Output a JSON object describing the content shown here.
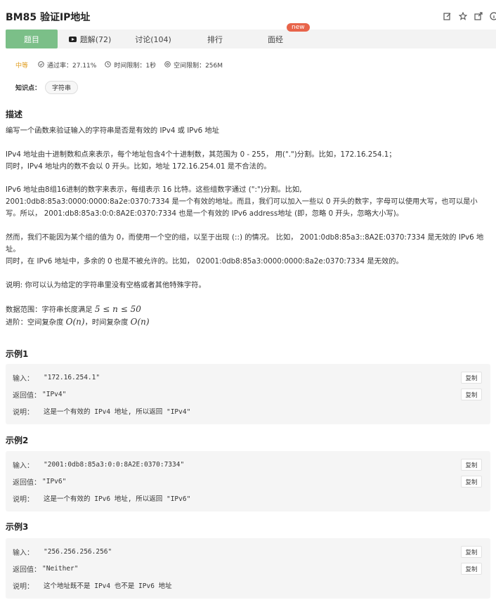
{
  "header": {
    "title": "BM85  验证IP地址",
    "icons": [
      "edit-icon",
      "star-icon",
      "share-icon",
      "info-icon"
    ]
  },
  "tabs": [
    {
      "label": "题目",
      "active": true
    },
    {
      "label": "题解(72)",
      "icon": "video-icon"
    },
    {
      "label": "讨论(104)"
    },
    {
      "label": "排行"
    },
    {
      "label": "面经",
      "badge": "new"
    }
  ],
  "meta": {
    "difficulty": "中等",
    "pass_rate": "通过率：27.11%",
    "time_limit": "时间限制：1秒",
    "space_limit": "空间限制：256M"
  },
  "knowledge": {
    "label": "知识点：",
    "tag": "字符串"
  },
  "description": {
    "heading": "描述",
    "p1": "编写一个函数来验证输入的字符串是否是有效的 IPv4 或 IPv6 地址",
    "p2a": "IPv4 地址由十进制数和点来表示，每个地址包含4个十进制数，其范围为 0 - 255， 用(\".\")分割。比如，172.16.254.1；",
    "p2b": "同时，IPv4 地址内的数不会以 0 开头。比如，地址 172.16.254.01 是不合法的。",
    "p3a": "IPv6 地址由8组16进制的数字来表示，每组表示 16 比特。这些组数字通过 (\":\")分割。比如,",
    "p3b": "2001:0db8:85a3:0000:0000:8a2e:0370:7334 是一个有效的地址。而且，我们可以加入一些以 0 开头的数字，字母可以使用大写，也可以是小写。所以， 2001:db8:85a3:0:0:8A2E:0370:7334 也是一个有效的 IPv6 address地址 (即，忽略 0 开头，忽略大小写)。",
    "p4a": "然而，我们不能因为某个组的值为 0，而使用一个空的组，以至于出现 (::) 的情况。 比如， 2001:0db8:85a3::8A2E:0370:7334 是无效的 IPv6 地址。",
    "p4b": "同时，在 IPv6 地址中，多余的 0 也是不被允许的。比如， 02001:0db8:85a3:0000:0000:8a2e:0370:7334 是无效的。",
    "p5": "说明: 你可以认为给定的字符串里没有空格或者其他特殊字符。",
    "range_prefix": "数据范围：字符串长度满足 ",
    "range_math": "5 ≤ n ≤ 50",
    "adv_prefix": "进阶：空间复杂度 ",
    "adv_math1": "O(n)",
    "adv_mid": "，时间复杂度 ",
    "adv_math2": "O(n)"
  },
  "examples": [
    {
      "heading": "示例1",
      "input_label": "输入：",
      "input": "\"172.16.254.1\"",
      "output_label": "返回值：",
      "output": "\"IPv4\"",
      "explain_label": "说明：",
      "explain": "这是一个有效的 IPv4 地址, 所以返回 \"IPv4\"",
      "copy": "复制"
    },
    {
      "heading": "示例2",
      "input_label": "输入：",
      "input": "\"2001:0db8:85a3:0:0:8A2E:0370:7334\"",
      "output_label": "返回值：",
      "output": "\"IPv6\"",
      "explain_label": "说明：",
      "explain": "这是一个有效的 IPv6 地址, 所以返回 \"IPv6\"",
      "copy": "复制"
    },
    {
      "heading": "示例3",
      "input_label": "输入：",
      "input": "\"256.256.256.256\"",
      "output_label": "返回值：",
      "output": "\"Neither\"",
      "explain_label": "说明：",
      "explain": "这个地址既不是 IPv4 也不是 IPv6 地址",
      "copy": "复制"
    }
  ]
}
